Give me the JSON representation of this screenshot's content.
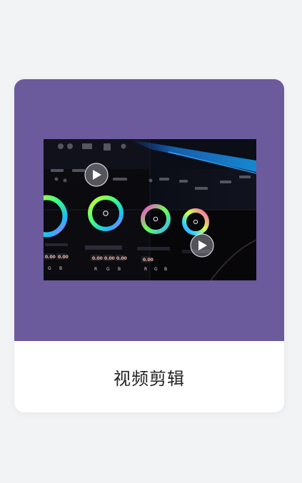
{
  "card": {
    "title": "视频剪辑",
    "accent_color": "#6b5a9c"
  },
  "preview": {
    "icons": [
      "play-button-icon",
      "play-button-icon"
    ],
    "numbers": [
      "0.00",
      "0.00",
      "0.00",
      "0.00",
      "0.00",
      "0.00"
    ],
    "channels": [
      "G",
      "B",
      "R",
      "G",
      "B",
      "R",
      "G",
      "B"
    ]
  }
}
